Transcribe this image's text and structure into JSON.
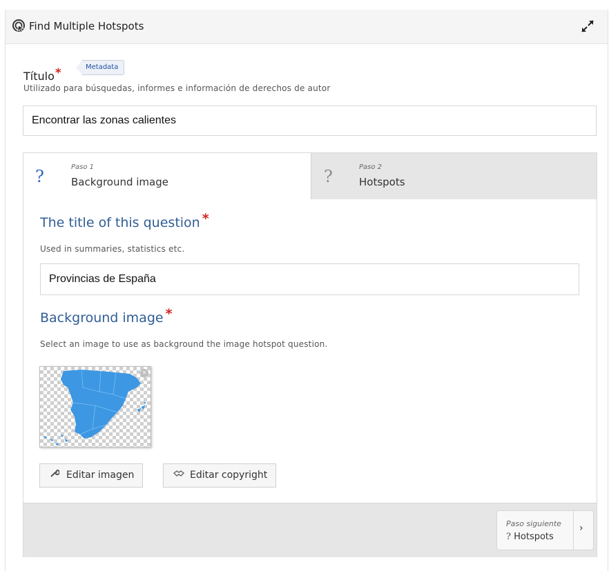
{
  "header": {
    "title": "Find Multiple Hotspots",
    "icon": "hotspot-icon",
    "expand_icon": "expand-icon"
  },
  "titulo": {
    "label": "Título",
    "required_mark": "*",
    "metadata_label": "Metadata",
    "description": "Utilizado para búsquedas, informes e información de derechos de autor",
    "value": "Encontrar las zonas calientes"
  },
  "wizard": {
    "tabs": [
      {
        "step": "Paso 1",
        "name": "Background image",
        "icon": "?"
      },
      {
        "step": "Paso 2",
        "name": "Hotspots",
        "icon": "?"
      }
    ],
    "question_title": {
      "label": "The title of this question",
      "required_mark": "*",
      "description": "Used in summaries, statistics etc.",
      "value": "Provincias de España"
    },
    "background_image": {
      "label": "Background image",
      "required_mark": "*",
      "description": "Select an image to use as background the image hotspot question.",
      "remove_glyph": "×"
    },
    "buttons": {
      "edit_image": "Editar imagen",
      "edit_copyright": "Editar copyright"
    },
    "next": {
      "step": "Paso siguiente",
      "icon": "?",
      "name": "Hotspots",
      "arrow": "›"
    }
  },
  "colors": {
    "accent": "#2f67b6",
    "heading": "#2f5d95",
    "required": "#d3241e",
    "map": "#3d97e3"
  }
}
